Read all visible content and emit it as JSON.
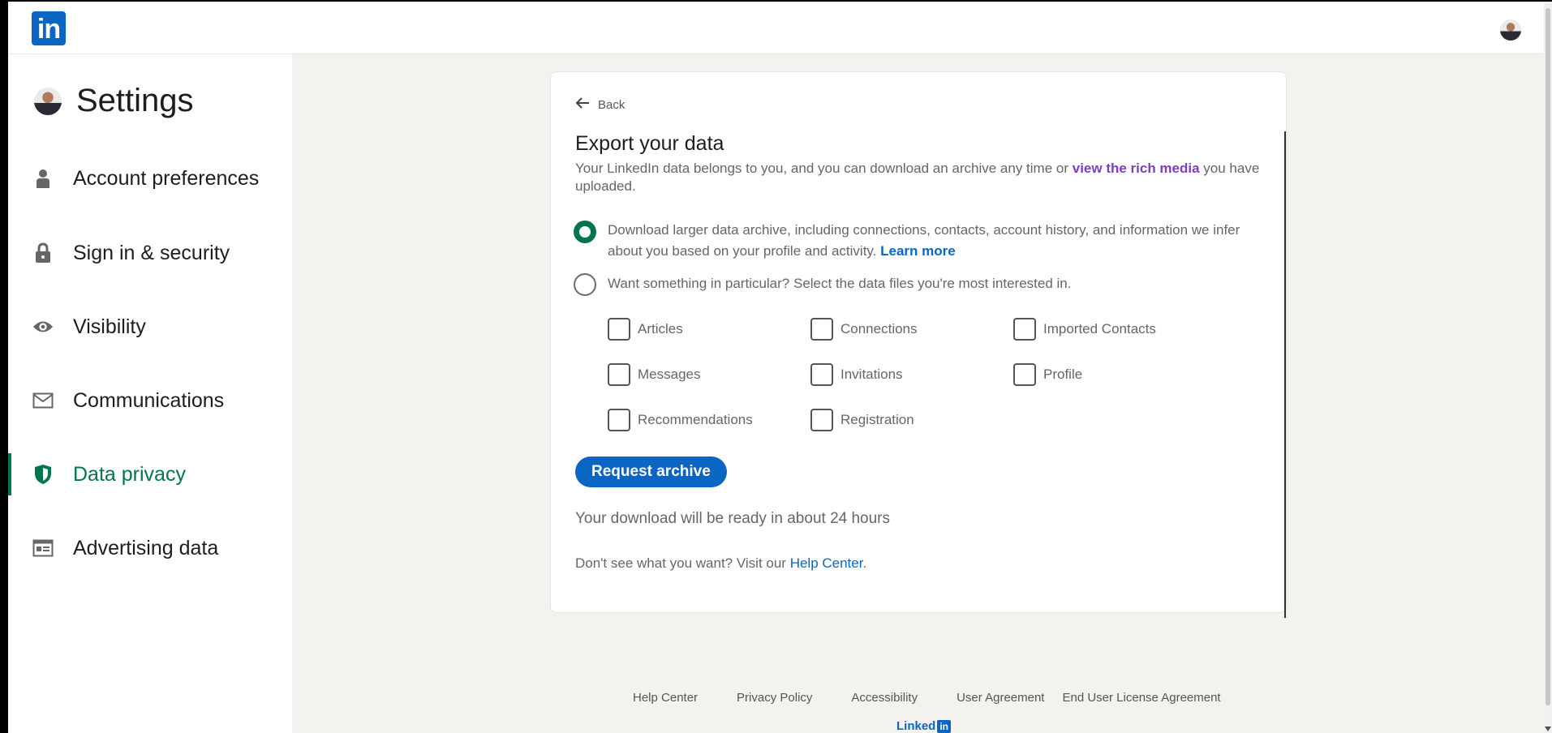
{
  "header": {
    "logo_text": "in"
  },
  "sidebar": {
    "title": "Settings",
    "items": [
      {
        "label": "Account preferences",
        "icon": "person-icon"
      },
      {
        "label": "Sign in & security",
        "icon": "lock-icon"
      },
      {
        "label": "Visibility",
        "icon": "eye-icon"
      },
      {
        "label": "Communications",
        "icon": "envelope-icon"
      },
      {
        "label": "Data privacy",
        "icon": "shield-icon",
        "active": true
      },
      {
        "label": "Advertising data",
        "icon": "ad-icon"
      }
    ]
  },
  "card": {
    "back_label": "Back",
    "title": "Export your data",
    "intro_before": "Your LinkedIn data belongs to you, and you can download an archive any time or ",
    "intro_link": "view the rich media",
    "intro_after": " you have uploaded.",
    "option_larger": {
      "label": "Download larger data archive, including connections, contacts, account history, and information we infer about you based on your profile and activity. ",
      "link": "Learn more",
      "checked": true
    },
    "option_particular": {
      "label": "Want something in particular? Select the data files you're most interested in.",
      "checked": false
    },
    "checkboxes": [
      "Articles",
      "Connections",
      "Imported Contacts",
      "Messages",
      "Invitations",
      "Profile",
      "Recommendations",
      "Registration"
    ],
    "request_button": "Request archive",
    "ready_text": "Your download will be ready in about 24 hours",
    "help_before": "Don't see what you want? Visit our ",
    "help_link": "Help Center",
    "help_after": "."
  },
  "footer": {
    "links": [
      "Help Center",
      "Privacy Policy",
      "Accessibility",
      "User Agreement",
      "End User License Agreement"
    ],
    "brand_text": "Linked",
    "brand_box": "in"
  },
  "colors": {
    "brand_blue": "#0a66c2",
    "active_green": "#01754f",
    "visited_purple": "#7b3fbf"
  }
}
